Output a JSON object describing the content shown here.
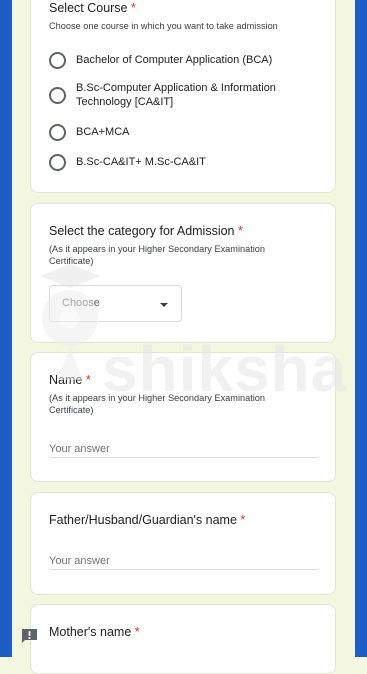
{
  "course": {
    "title": "Select Course",
    "required_mark": "*",
    "help": "Choose one course in which you want to take admission",
    "options": [
      "Bachelor of Computer Application (BCA)",
      "B.Sc-Computer Application & Information Technology [CA&IT]",
      "BCA+MCA",
      "B.Sc-CA&IT+ M.Sc-CA&IT"
    ]
  },
  "category": {
    "title": "Select the category for Admission",
    "required_mark": "*",
    "help": "(As it appears in your Higher Secondary Examination Certificate)",
    "dropdown_value": "Choose"
  },
  "name": {
    "title": "Name",
    "required_mark": "*",
    "help": "(As it appears in your Higher Secondary Examination Certificate)",
    "placeholder": "Your answer"
  },
  "guardian": {
    "title": "Father/Husband/Guardian's name",
    "required_mark": "*",
    "placeholder": "Your answer"
  },
  "mother": {
    "title": "Mother's name",
    "required_mark": "*"
  },
  "watermark": {
    "text": "shiksha"
  },
  "icons": {
    "feedback": "feedback-icon",
    "dropdown": "caret-down-icon"
  },
  "colors": {
    "side_bar": "#1d5ec4",
    "page_bg": "#f3f7e0",
    "required": "#d93025"
  }
}
